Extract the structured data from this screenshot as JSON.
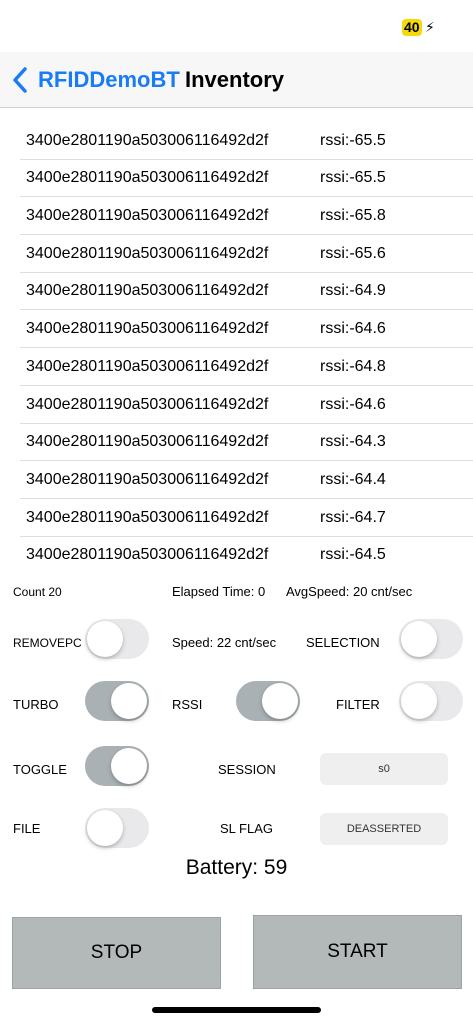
{
  "status_bar": {
    "battery_level": "40",
    "charging_symbol": "⚡"
  },
  "nav": {
    "back_label": "RFIDDemoBT",
    "title": "Inventory"
  },
  "tags": [
    {
      "epc": "3400e2801190a503006116492d2f",
      "rssi": "rssi:-65.5"
    },
    {
      "epc": "3400e2801190a503006116492d2f",
      "rssi": "rssi:-65.5"
    },
    {
      "epc": "3400e2801190a503006116492d2f",
      "rssi": "rssi:-65.8"
    },
    {
      "epc": "3400e2801190a503006116492d2f",
      "rssi": "rssi:-65.6"
    },
    {
      "epc": "3400e2801190a503006116492d2f",
      "rssi": "rssi:-64.9"
    },
    {
      "epc": "3400e2801190a503006116492d2f",
      "rssi": "rssi:-64.6"
    },
    {
      "epc": "3400e2801190a503006116492d2f",
      "rssi": "rssi:-64.8"
    },
    {
      "epc": "3400e2801190a503006116492d2f",
      "rssi": "rssi:-64.6"
    },
    {
      "epc": "3400e2801190a503006116492d2f",
      "rssi": "rssi:-64.3"
    },
    {
      "epc": "3400e2801190a503006116492d2f",
      "rssi": "rssi:-64.4"
    },
    {
      "epc": "3400e2801190a503006116492d2f",
      "rssi": "rssi:-64.7"
    },
    {
      "epc": "3400e2801190a503006116492d2f",
      "rssi": "rssi:-64.5"
    }
  ],
  "stats": {
    "count": "Count 20",
    "elapsed": "Elapsed Time: 0",
    "avg_speed": "AvgSpeed: 20 cnt/sec",
    "speed": "Speed: 22 cnt/sec"
  },
  "controls": {
    "removepc": {
      "label": "REMOVEPC",
      "on": false
    },
    "selection": {
      "label": "SELECTION",
      "on": false
    },
    "turbo": {
      "label": "TURBO",
      "on": true
    },
    "rssi": {
      "label": "RSSI",
      "on": true
    },
    "filter": {
      "label": "FILTER",
      "on": false
    },
    "toggle": {
      "label": "TOGGLE",
      "on": true
    },
    "file": {
      "label": "FILE",
      "on": false
    },
    "session": {
      "label": "SESSION",
      "value": "s0"
    },
    "sl_flag": {
      "label": "SL FLAG",
      "value": "DEASSERTED"
    }
  },
  "battery": "Battery: 59",
  "buttons": {
    "stop": "STOP",
    "start": "START"
  },
  "colors": {
    "accent": "#1a7cf5",
    "switch_on": "#a9b1b4",
    "switch_off": "#e9e9eb",
    "button_bg": "#b3b8b8",
    "battery_badge": "#f5d90a"
  }
}
